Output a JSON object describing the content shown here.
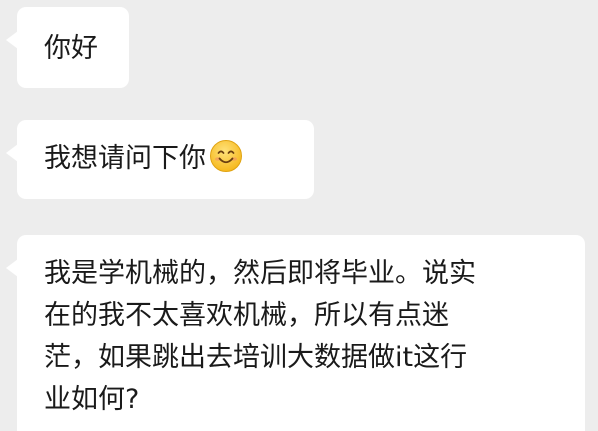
{
  "messages": [
    {
      "sender": "other",
      "lines": [
        "你好"
      ]
    },
    {
      "sender": "other",
      "lines": [
        "我想请问下你"
      ],
      "trailing_icon": "smiling-face-emoji"
    },
    {
      "sender": "other",
      "lines": [
        "我是学机械的，然后即将毕业。说实",
        "在的我不太喜欢机械，所以有点迷",
        "茫，如果跳出去培训大数据做it这行",
        "业如何?"
      ]
    }
  ],
  "colors": {
    "background": "#ededed",
    "bubble": "#ffffff",
    "text": "#1a1a1a",
    "emoji_face": "#ffcc33"
  }
}
